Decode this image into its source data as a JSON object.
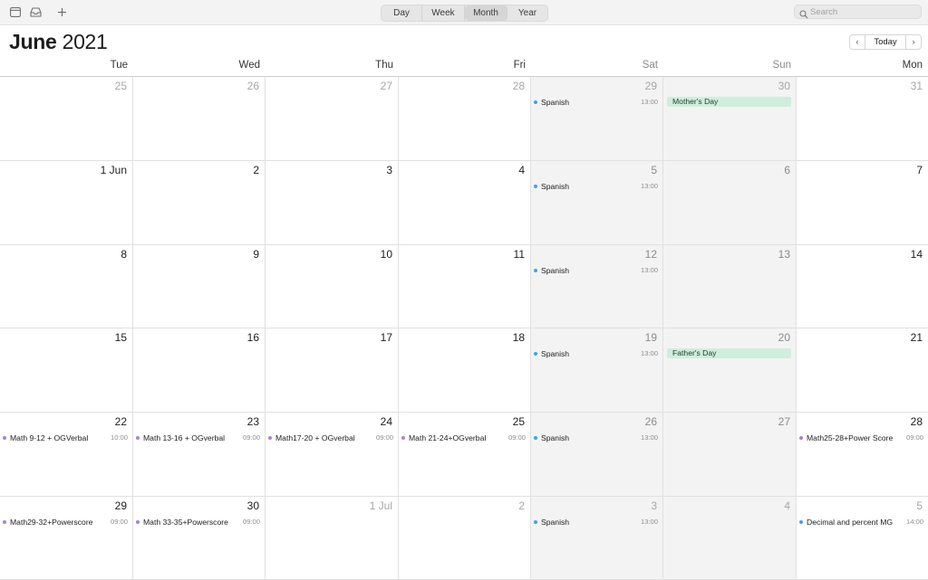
{
  "toolbar": {
    "view_tabs": [
      {
        "label": "Day",
        "active": false
      },
      {
        "label": "Week",
        "active": false
      },
      {
        "label": "Month",
        "active": true
      },
      {
        "label": "Year",
        "active": false
      }
    ],
    "search_placeholder": "Search",
    "icons": [
      "calendars-icon",
      "inbox-icon",
      "add-icon",
      "search-icon"
    ]
  },
  "header": {
    "month": "June",
    "year": "2021",
    "today_label": "Today",
    "prev_icon": "chevron-left-icon",
    "next_icon": "chevron-right-icon"
  },
  "weekdays": [
    {
      "label": "Tue",
      "weekend": false
    },
    {
      "label": "Wed",
      "weekend": false
    },
    {
      "label": "Thu",
      "weekend": false
    },
    {
      "label": "Fri",
      "weekend": false
    },
    {
      "label": "Sat",
      "weekend": true
    },
    {
      "label": "Sun",
      "weekend": true
    },
    {
      "label": "Mon",
      "weekend": false
    }
  ],
  "colors": {
    "event_blue": "#3fa3e6",
    "event_purple": "#a77fe0",
    "holiday_bg": "#cfeedd",
    "weekend_bg": "#f3f3f3"
  },
  "weeks": [
    [
      {
        "day": "25",
        "muted": true
      },
      {
        "day": "26",
        "muted": true
      },
      {
        "day": "27",
        "muted": true
      },
      {
        "day": "28",
        "muted": true
      },
      {
        "day": "29",
        "muted": true,
        "event": {
          "name": "Spanish",
          "time": "13:00",
          "color": "blue"
        }
      },
      {
        "day": "30",
        "muted": true,
        "allday": "Mother's Day"
      },
      {
        "day": "31",
        "muted": true
      }
    ],
    [
      {
        "day": "1 Jun"
      },
      {
        "day": "2"
      },
      {
        "day": "3"
      },
      {
        "day": "4"
      },
      {
        "day": "5",
        "event": {
          "name": "Spanish",
          "time": "13:00",
          "color": "blue"
        }
      },
      {
        "day": "6"
      },
      {
        "day": "7"
      }
    ],
    [
      {
        "day": "8"
      },
      {
        "day": "9"
      },
      {
        "day": "10"
      },
      {
        "day": "11"
      },
      {
        "day": "12",
        "event": {
          "name": "Spanish",
          "time": "13:00",
          "color": "blue"
        }
      },
      {
        "day": "13"
      },
      {
        "day": "14"
      }
    ],
    [
      {
        "day": "15"
      },
      {
        "day": "16"
      },
      {
        "day": "17"
      },
      {
        "day": "18"
      },
      {
        "day": "19",
        "event": {
          "name": "Spanish",
          "time": "13:00",
          "color": "blue"
        }
      },
      {
        "day": "20",
        "allday": "Father's Day"
      },
      {
        "day": "21"
      }
    ],
    [
      {
        "day": "22",
        "event": {
          "name": "Math 9-12 + OGVerbal",
          "time": "10:00",
          "color": "purple"
        }
      },
      {
        "day": "23",
        "event": {
          "name": "Math 13-16 + OGverbal",
          "time": "09:00",
          "color": "purple"
        }
      },
      {
        "day": "24",
        "event": {
          "name": "Math17-20 + OGverbal",
          "time": "09:00",
          "color": "purple"
        }
      },
      {
        "day": "25",
        "event": {
          "name": "Math 21-24+OGverbal",
          "time": "09:00",
          "color": "purple"
        }
      },
      {
        "day": "26",
        "event": {
          "name": "Spanish",
          "time": "13:00",
          "color": "blue"
        }
      },
      {
        "day": "27"
      },
      {
        "day": "28",
        "event": {
          "name": "Math25-28+Power Score",
          "time": "09:00",
          "color": "purple"
        }
      }
    ],
    [
      {
        "day": "29",
        "event": {
          "name": "Math29-32+Powerscore",
          "time": "09:00",
          "color": "purple"
        }
      },
      {
        "day": "30",
        "event": {
          "name": "Math 33-35+Powerscore",
          "time": "09:00",
          "color": "purple"
        }
      },
      {
        "day": "1 Jul",
        "muted": true
      },
      {
        "day": "2",
        "muted": true
      },
      {
        "day": "3",
        "muted": true,
        "event": {
          "name": "Spanish",
          "time": "13:00",
          "color": "blue"
        }
      },
      {
        "day": "4",
        "muted": true
      },
      {
        "day": "5",
        "muted": true,
        "event": {
          "name": "Decimal and percent MG",
          "time": "14:00",
          "color": "blue"
        }
      }
    ]
  ]
}
